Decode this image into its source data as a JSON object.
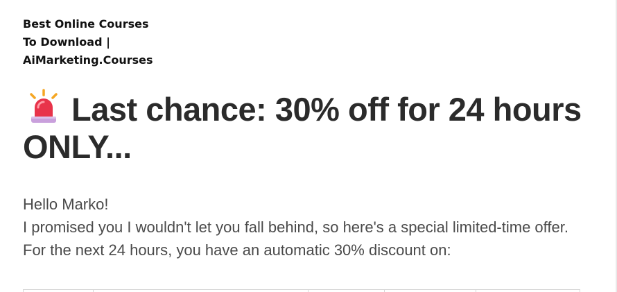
{
  "brand": {
    "line1": "Best Online Courses",
    "line2": "To Download |",
    "line3": "AiMarketing.Courses"
  },
  "headline": {
    "icon": "siren-icon",
    "text": "Last chance: 30% off for 24 hours ONLY..."
  },
  "body": {
    "greeting": "Hello Marko!",
    "paragraph1": "I promised you I wouldn't let you fall behind, so here's a special limited-time offer.",
    "paragraph2": "For the next 24 hours, you have an automatic 30% discount on:"
  },
  "colors": {
    "heading": "#2b2b2b",
    "body": "#4a4a4a",
    "siren_red": "#e8334a",
    "siren_base": "#c9a0dc",
    "siren_rays": "#f5a623"
  }
}
